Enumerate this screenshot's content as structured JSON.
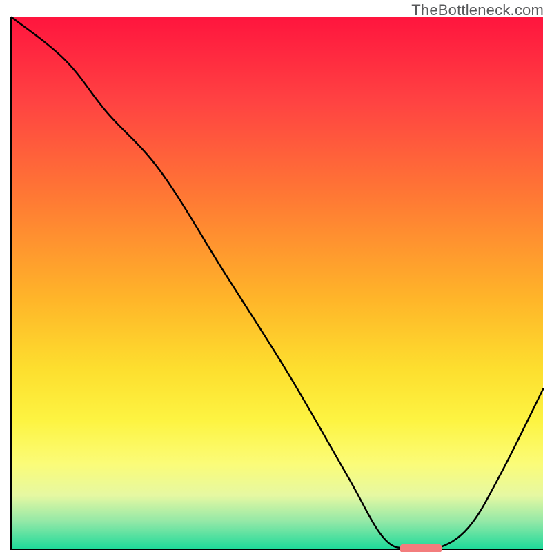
{
  "watermark": "TheBottleneck.com",
  "chart_data": {
    "type": "line",
    "title": "",
    "xlabel": "",
    "ylabel": "",
    "xlim": [
      0,
      100
    ],
    "ylim": [
      0,
      100
    ],
    "grid": false,
    "legend": false,
    "series": [
      {
        "name": "curve",
        "x": [
          0,
          10,
          18,
          28,
          40,
          52,
          63,
          70,
          75,
          80,
          86,
          92,
          100
        ],
        "y": [
          100,
          92,
          82,
          71,
          52,
          33,
          14,
          2,
          0,
          0,
          4,
          14,
          30
        ]
      }
    ],
    "marker": {
      "x_start": 73,
      "x_end": 81,
      "y": 0,
      "color": "#f37d7d"
    },
    "gradient_stops": [
      {
        "pos": 0,
        "color": "#ff153e"
      },
      {
        "pos": 16,
        "color": "#ff4342"
      },
      {
        "pos": 34,
        "color": "#ff7934"
      },
      {
        "pos": 53,
        "color": "#ffb529"
      },
      {
        "pos": 66,
        "color": "#fdde2e"
      },
      {
        "pos": 76,
        "color": "#fdf442"
      },
      {
        "pos": 84,
        "color": "#fbfc78"
      },
      {
        "pos": 90,
        "color": "#e6f8a2"
      },
      {
        "pos": 95,
        "color": "#91e8a7"
      },
      {
        "pos": 100,
        "color": "#1fda9a"
      }
    ]
  }
}
